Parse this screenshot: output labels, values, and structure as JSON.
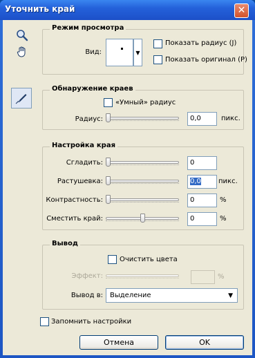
{
  "window": {
    "title": "Уточнить край",
    "close_glyph": "✕"
  },
  "tools": {
    "zoom": "zoom-icon",
    "hand": "hand-icon",
    "refine": "refine-radius-brush-icon"
  },
  "view_mode": {
    "legend": "Режим просмотра",
    "view_label": "Вид:",
    "show_radius": "Показать радиус (J)",
    "show_original": "Показать оригинал (P)"
  },
  "edge_detection": {
    "legend": "Обнаружение краев",
    "smart_radius": "«Умный» радиус",
    "radius_label": "Радиус:",
    "radius_value": "0,0",
    "radius_unit": "пикс."
  },
  "adjust_edge": {
    "legend": "Настройка края",
    "smooth_label": "Сгладить:",
    "smooth_value": "0",
    "feather_label": "Растушевка:",
    "feather_value": "0,0",
    "feather_unit": "пикс.",
    "contrast_label": "Контрастность:",
    "contrast_value": "0",
    "contrast_unit": "%",
    "shift_label": "Сместить край:",
    "shift_value": "0",
    "shift_unit": "%",
    "shift_level": 0.5
  },
  "output": {
    "legend": "Вывод",
    "decontaminate": "Очистить цвета",
    "amount_label": "Эффект:",
    "amount_value": "",
    "amount_unit": "%",
    "output_to_label": "Вывод в:",
    "output_to_value": "Выделение"
  },
  "remember": "Запомнить настройки",
  "buttons": {
    "cancel": "Отмена",
    "ok": "OK"
  }
}
